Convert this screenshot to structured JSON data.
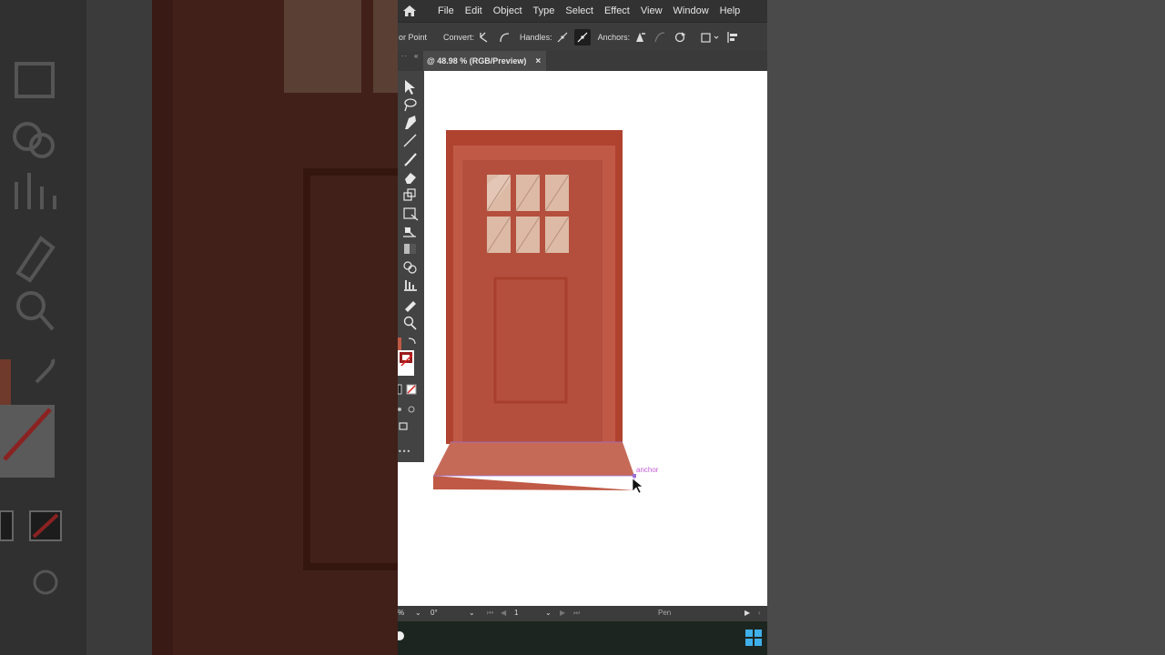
{
  "menu": {
    "items": [
      "File",
      "Edit",
      "Object",
      "Type",
      "Select",
      "Effect",
      "View",
      "Window",
      "Help"
    ]
  },
  "control_bar": {
    "anchor_point_label": "or Point",
    "convert_label": "Convert:",
    "handles_label": "Handles:",
    "anchors_label": "Anchors:"
  },
  "document_tab": {
    "title": "@ 48.98 % (RGB/Preview)",
    "close": "×"
  },
  "status_bar": {
    "zoom_suffix": "%",
    "rotation": "0°",
    "artboard": "1",
    "tool": "Pen"
  },
  "canvas": {
    "anchor_hint": "anchor"
  },
  "colors": {
    "door_frame": "#b04330",
    "door": "#c05a46",
    "door_inner": "#b44f3e",
    "glass": "#dcbaa6",
    "step": "#c05a46",
    "path": "#9b6fd6",
    "anchor_hint": "#c65ad9"
  },
  "icons": {
    "home": "home-icon",
    "windows": "windows-start-icon"
  }
}
